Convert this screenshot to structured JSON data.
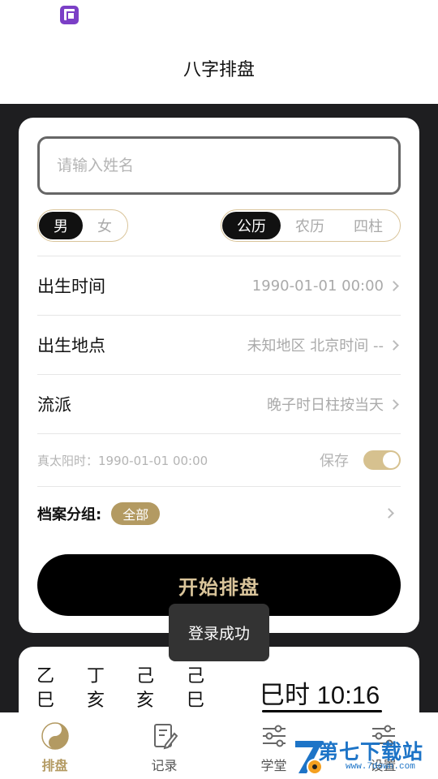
{
  "header": {
    "title": "八字排盘"
  },
  "form": {
    "name_placeholder": "请输入姓名",
    "gender": [
      {
        "label": "男",
        "active": true
      },
      {
        "label": "女",
        "active": false
      }
    ],
    "calendar": [
      {
        "label": "公历",
        "active": true
      },
      {
        "label": "农历",
        "active": false
      },
      {
        "label": "四柱",
        "active": false
      }
    ],
    "rows": [
      {
        "label": "出生时间",
        "value": "1990-01-01 00:00"
      },
      {
        "label": "出生地点",
        "value": "未知地区 北京时间 --"
      },
      {
        "label": "流派",
        "value": "晚子时日柱按当天"
      }
    ],
    "solar_time": "真太阳时：1990-01-01 00:00",
    "save_label": "保存",
    "save_enabled": true,
    "group_label": "档案分组:",
    "group_value": "全部",
    "start_button": "开始排盘"
  },
  "toast": "登录成功",
  "today": {
    "pillars_top": [
      "乙",
      "丁",
      "己",
      "己"
    ],
    "pillars_bottom": [
      "巳",
      "亥",
      "亥",
      "巳"
    ],
    "time": "巳时 10:16"
  },
  "tabs": [
    {
      "label": "排盘",
      "icon": "yin-yang-icon",
      "active": true
    },
    {
      "label": "记录",
      "icon": "edit-note-icon",
      "active": false
    },
    {
      "label": "学堂",
      "icon": "sliders-icon",
      "active": false
    },
    {
      "label": "设置",
      "icon": "sliders-icon",
      "active": false
    }
  ],
  "watermark": {
    "text": "第七下载站",
    "url": "www.7down.com"
  },
  "colors": {
    "accent": "#b39a62",
    "toggle": "#d6c18f",
    "segment_border": "#d9c49a",
    "button_text": "#d9c49a"
  }
}
